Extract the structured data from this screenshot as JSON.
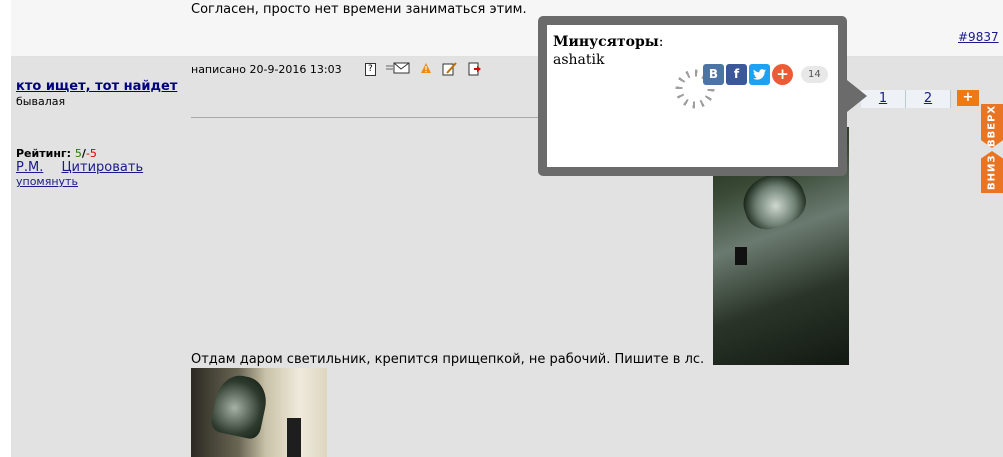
{
  "prev_post": {
    "text": "Согласен, просто нет времени заниматься этим.",
    "number": "#9837"
  },
  "post": {
    "author": "кто ищет, тот найдет",
    "status": "бывалая",
    "rating_label": "Рейтинг:",
    "rating_pos": "5",
    "rating_sep": "/",
    "rating_neg": "-5",
    "link_pm": "Р.М.",
    "link_quote": "Цитировать",
    "link_mention": "упомянуть",
    "meta": "написано 20-9-2016 13:03",
    "text": "Отдам даром светильник, крепится прищепкой, не рабочий. Пишите в лс.",
    "tools": {
      "profile_icon": "profile-card-icon",
      "pm_icon": "envelope-icon",
      "warn_icon": "warning-icon",
      "edit_icon": "edit-icon",
      "goto_icon": "goto-icon"
    }
  },
  "pagination": {
    "pages": [
      "1",
      "2"
    ],
    "plus": "+"
  },
  "popup": {
    "title": "Минусяторы",
    "title_colon": ":",
    "user": "ashatik",
    "share": {
      "vk": "В",
      "fb": "f",
      "plus": "+",
      "count": "14"
    }
  },
  "side": {
    "up": "ВВЕРХ",
    "down": "ВНИЗ"
  },
  "colors": {
    "accent": "#e87424",
    "post_bg": "#e1e2e1",
    "link": "#1a1a8c"
  }
}
